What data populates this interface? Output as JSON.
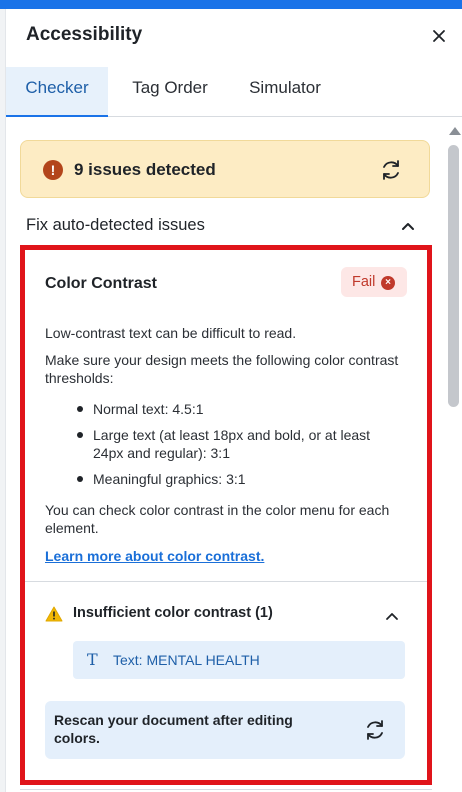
{
  "header": {
    "title": "Accessibility"
  },
  "tabs": [
    {
      "label": "Checker"
    },
    {
      "label": "Tag Order"
    },
    {
      "label": "Simulator"
    }
  ],
  "banner": {
    "icon_symbol": "!",
    "text": "9 issues detected"
  },
  "fix_section": {
    "label": "Fix auto-detected issues"
  },
  "card": {
    "title": "Color Contrast",
    "status": "Fail",
    "status_icon": "×",
    "paragraphs": [
      "Low-contrast text can be difficult to read.",
      "Make sure your design meets the following color contrast thresholds:",
      "You can check color contrast in the color menu for each element."
    ],
    "bullets": [
      "Normal text: 4.5:1",
      "Large text (at least 18px and bold, or at least 24px and regular): 3:1",
      "Meaningful graphics: 3:1"
    ],
    "link": "Learn more about color contrast."
  },
  "issue_group": {
    "label": "Insufficient color contrast (1)",
    "item_icon": "T",
    "item_label": "Text: MENTAL HEALTH"
  },
  "rescan": {
    "text": "Rescan your document after editing colors."
  },
  "colors": {
    "accent": "#1a73e8",
    "fail": "#c0392b",
    "warning_bg": "#fdecc4",
    "highlight_border": "#e0141a"
  }
}
